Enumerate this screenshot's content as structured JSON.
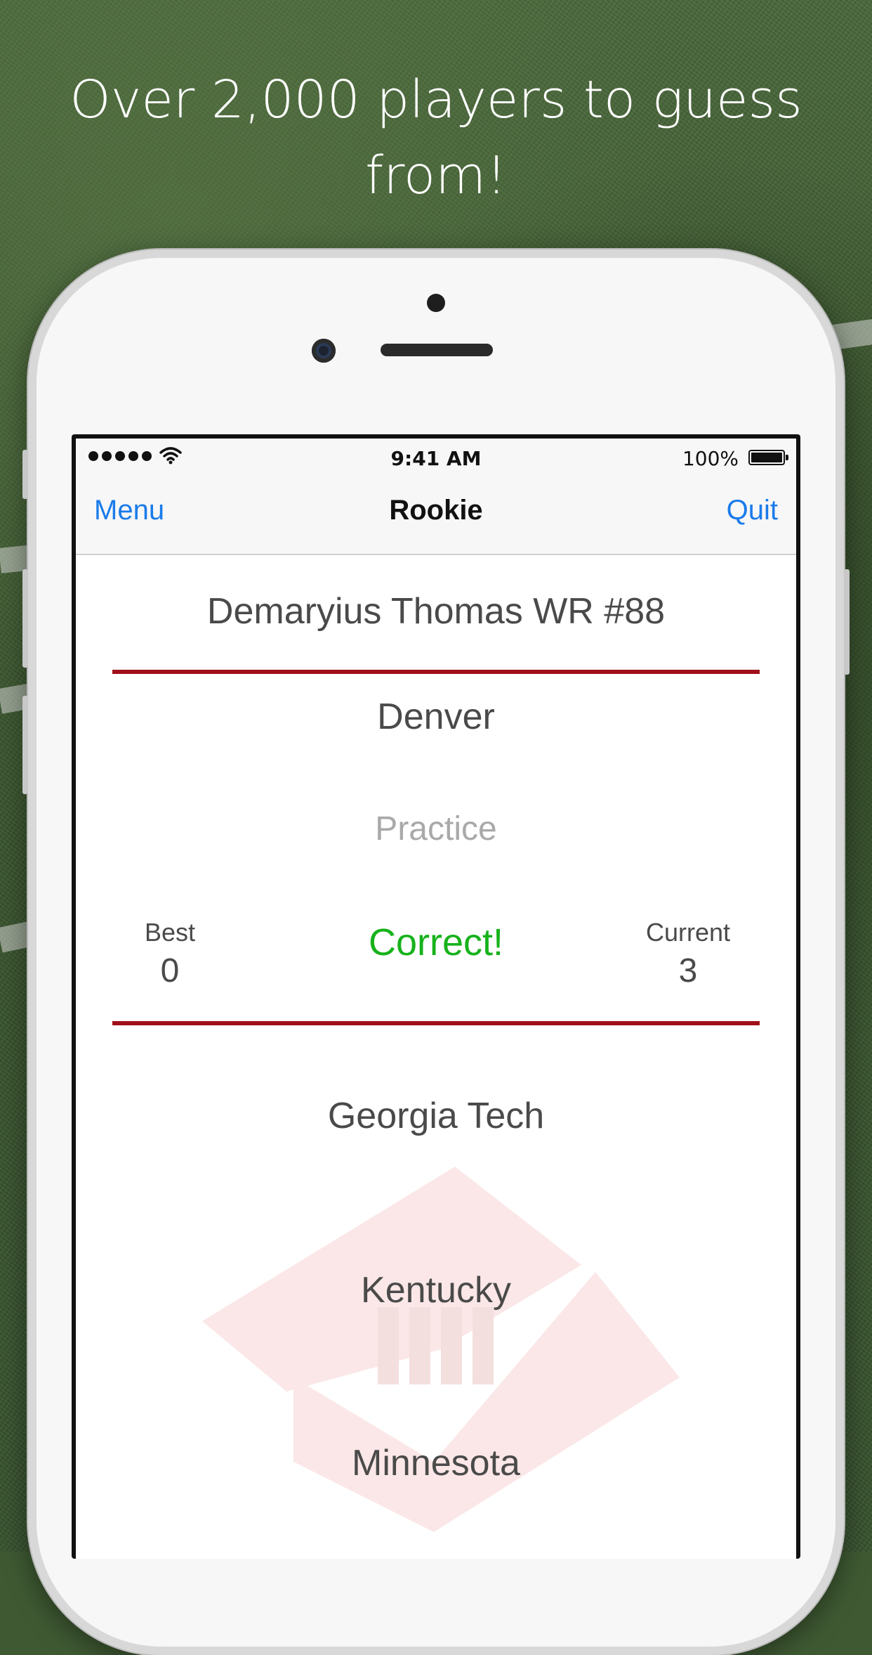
{
  "promo": {
    "headline": "Over 2,000 players to guess from!"
  },
  "status_bar": {
    "time": "9:41 AM",
    "battery": "100%"
  },
  "nav": {
    "left": "Menu",
    "title": "Rookie",
    "right": "Quit"
  },
  "quiz": {
    "player": "Demaryius Thomas WR #88",
    "team": "Denver",
    "mode": "Practice",
    "result": "Correct!",
    "best_label": "Best",
    "best_value": "0",
    "current_label": "Current",
    "current_value": "3",
    "choices": [
      "Georgia Tech",
      "Kentucky",
      "Minnesota"
    ]
  },
  "colors": {
    "accent_blue": "#1a7bea",
    "rule_red": "#a0101a",
    "correct_green": "#17b21b",
    "watermark_pink": "#f6dede"
  }
}
